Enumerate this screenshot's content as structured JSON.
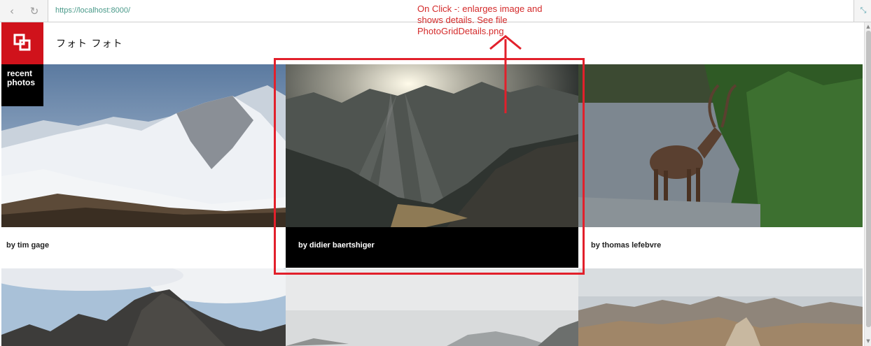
{
  "browser": {
    "back_icon": "back-arrow-icon",
    "reload_icon": "reload-icon",
    "url": "https://localhost:8000/",
    "extension_icon": "collapse-arrows-icon"
  },
  "app": {
    "logo_icon": "overlapping-squares-icon",
    "title": "フォト フォト",
    "recent_line1": "recent",
    "recent_line2": "photos",
    "brand_color": "#d0121b"
  },
  "photos": [
    {
      "credit": "by tim gage",
      "subject": "snowy-mountain-ridge"
    },
    {
      "credit": "by didier baertshiger",
      "subject": "sun-rays-over-mountain-valley"
    },
    {
      "credit": "by thomas lefebvre",
      "subject": "caribou-in-river"
    },
    {
      "credit": "",
      "subject": "rocky-peaks-under-clouds"
    },
    {
      "credit": "",
      "subject": "hazy-mountain-landscape"
    },
    {
      "credit": "",
      "subject": "desert-mountain-range"
    }
  ],
  "annotation": {
    "line1": "On Click -: enlarges image and",
    "line2": "shows details. See file",
    "line3": "PhotoGridDetails.png",
    "color": "#e2202b"
  }
}
